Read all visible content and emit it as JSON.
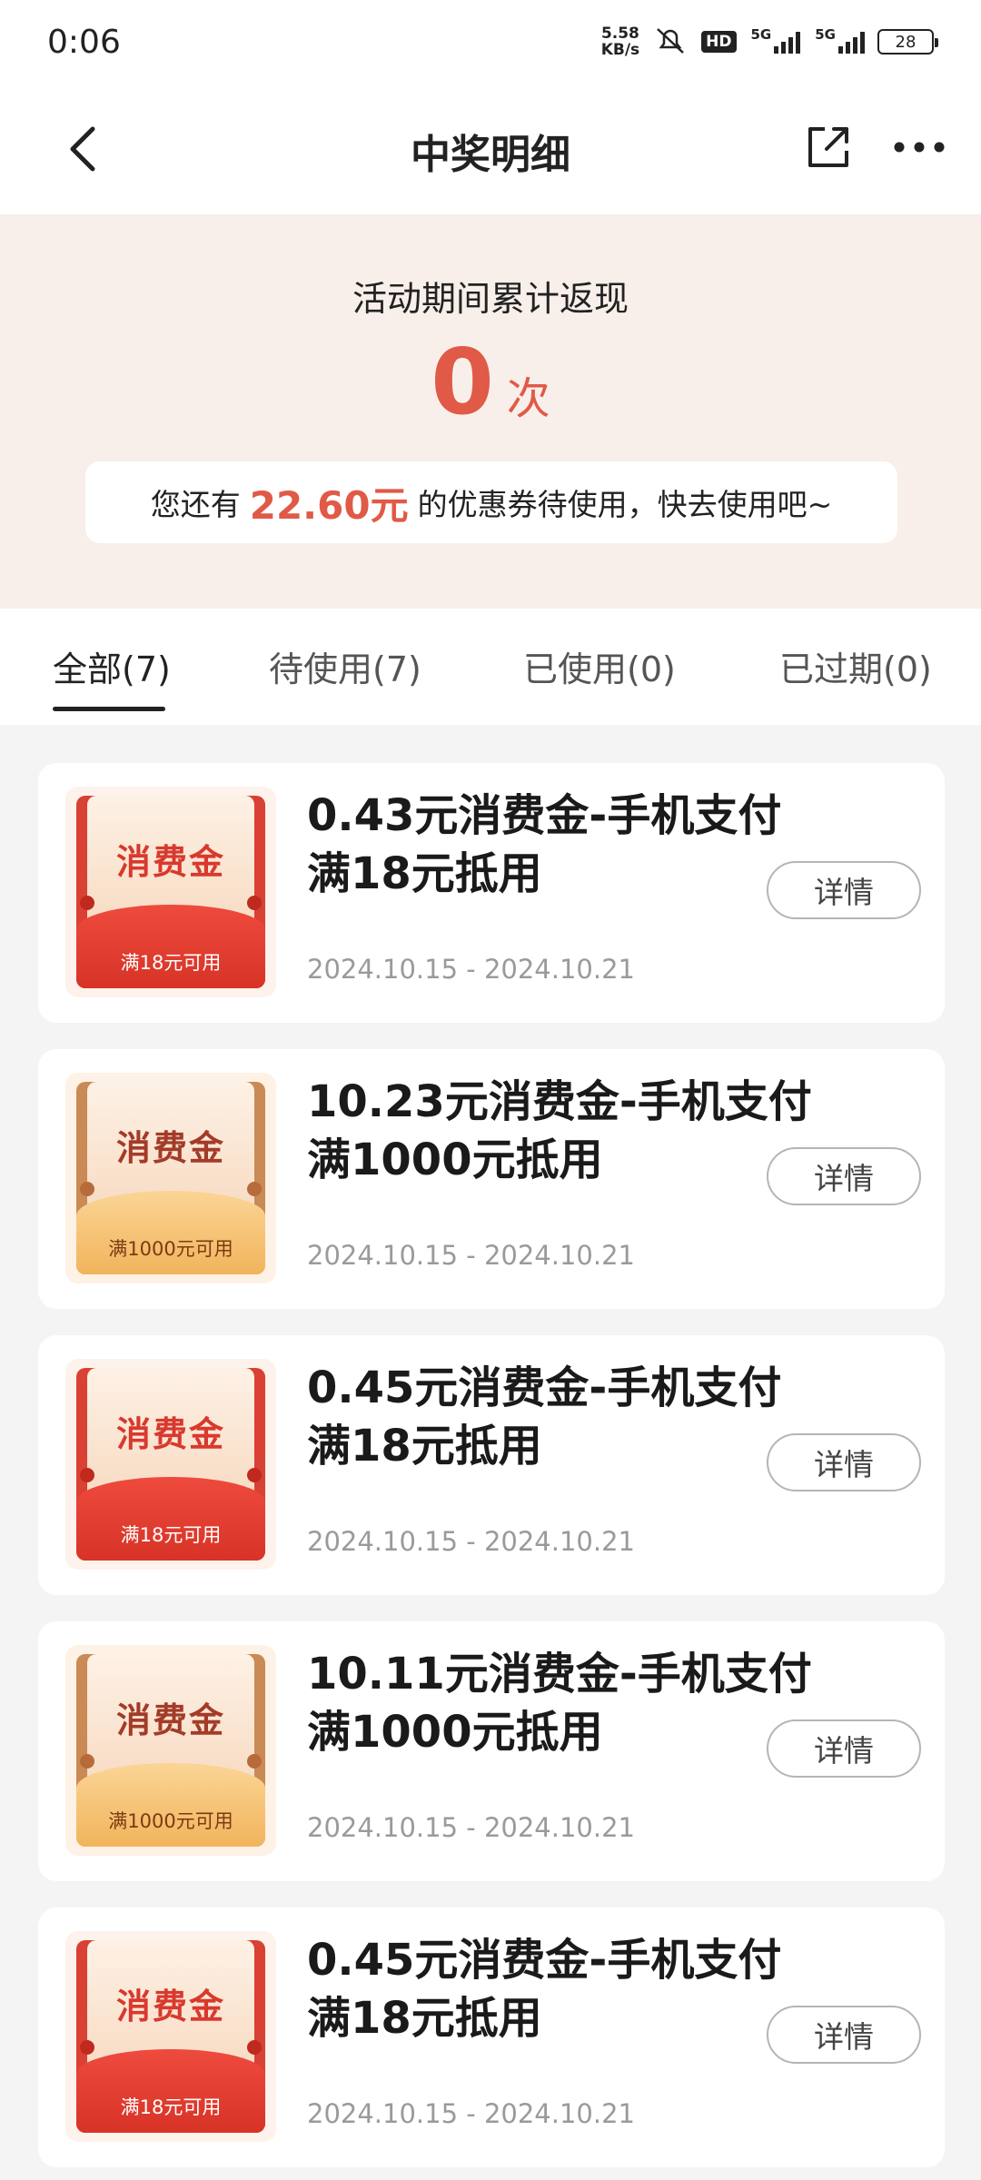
{
  "status_bar": {
    "time": "0:06",
    "net_speed_value": "5.58",
    "net_speed_unit": "KB/s",
    "hd_badge": "HD",
    "network1": "5G",
    "network2": "5G",
    "battery": "28"
  },
  "header": {
    "title": "中奖明细",
    "back_icon": "chevron-left-icon",
    "share_icon": "share-icon",
    "more_icon": "more-icon"
  },
  "summary": {
    "label": "活动期间累计返现",
    "count": "0",
    "unit": "次",
    "banner_prefix": "您还有",
    "banner_amount": "22.60元",
    "banner_suffix": "的优惠券待使用，快去使用吧~"
  },
  "tabs": [
    {
      "label": "全部(7)",
      "active": true
    },
    {
      "label": "待使用(7)",
      "active": false
    },
    {
      "label": "已使用(0)",
      "active": false
    },
    {
      "label": "已过期(0)",
      "active": false
    }
  ],
  "coupons": [
    {
      "badge_title": "消费金",
      "badge_condition": "满18元可用",
      "style": "red",
      "title": "0.43元消费金-手机支付满18元抵用",
      "date": "2024.10.15 - 2024.10.21",
      "button": "详情"
    },
    {
      "badge_title": "消费金",
      "badge_condition": "满1000元可用",
      "style": "gold",
      "title": "10.23元消费金-手机支付满1000元抵用",
      "date": "2024.10.15 - 2024.10.21",
      "button": "详情"
    },
    {
      "badge_title": "消费金",
      "badge_condition": "满18元可用",
      "style": "red",
      "title": "0.45元消费金-手机支付满18元抵用",
      "date": "2024.10.15 - 2024.10.21",
      "button": "详情"
    },
    {
      "badge_title": "消费金",
      "badge_condition": "满1000元可用",
      "style": "gold",
      "title": "10.11元消费金-手机支付满1000元抵用",
      "date": "2024.10.15 - 2024.10.21",
      "button": "详情"
    },
    {
      "badge_title": "消费金",
      "badge_condition": "满18元可用",
      "style": "red",
      "title": "0.45元消费金-手机支付满18元抵用",
      "date": "2024.10.15 - 2024.10.21",
      "button": "详情"
    }
  ],
  "colors": {
    "accent": "#e05a47",
    "summary_bg": "#f8efea",
    "page_bg": "#f4f4f4"
  }
}
